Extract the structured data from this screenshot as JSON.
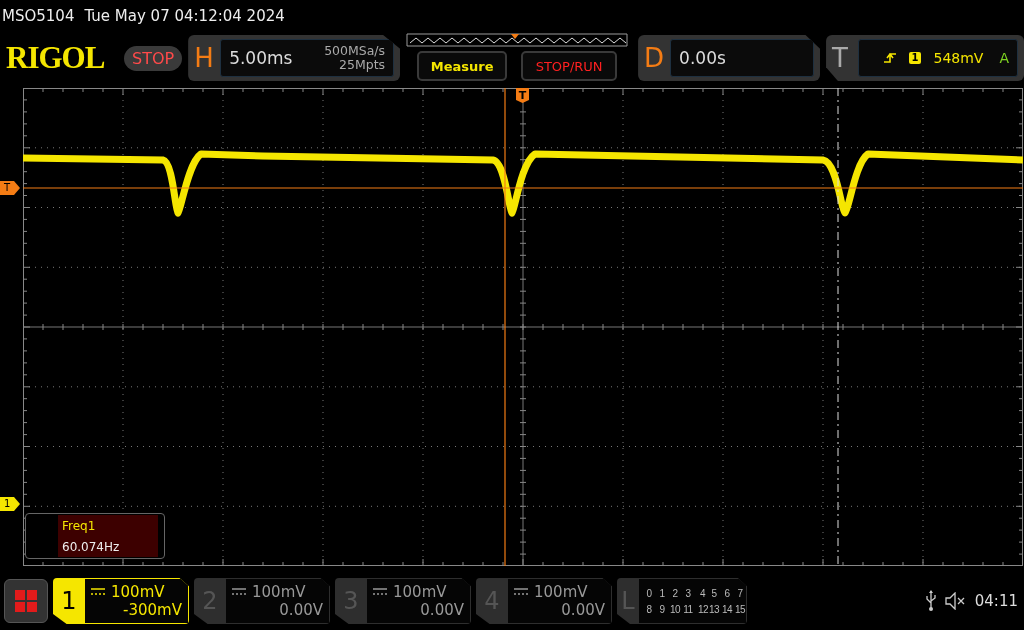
{
  "status_line": {
    "model": "MSO5104",
    "datetime": "Tue May 07 04:12:04 2024"
  },
  "header": {
    "logo": "RIGOL",
    "run_state": "STOP",
    "horizontal": {
      "label": "H",
      "timebase": "5.00ms",
      "sample_rate": "500MSa/s",
      "memory_depth": "25Mpts"
    },
    "buttons": [
      {
        "label": "Measure",
        "kind": "measure"
      },
      {
        "label": "STOP/RUN",
        "kind": "stoprun"
      }
    ],
    "delay": {
      "label": "D",
      "value": "0.00s"
    },
    "trigger": {
      "label": "T",
      "source": "1",
      "level": "548mV",
      "mode": "A"
    }
  },
  "display": {
    "trigger_position_marker": "T",
    "trigger_level_marker": "T",
    "channel_marker": "1",
    "measurement": {
      "name": "Freq1",
      "value": "60.074Hz"
    }
  },
  "channels": [
    {
      "number": "1",
      "scale": "100mV",
      "offset": "-300mV",
      "selected": true
    },
    {
      "number": "2",
      "scale": "100mV",
      "offset": "0.00V",
      "selected": false
    },
    {
      "number": "3",
      "scale": "100mV",
      "offset": "0.00V",
      "selected": false
    },
    {
      "number": "4",
      "scale": "100mV",
      "offset": "0.00V",
      "selected": false
    }
  ],
  "logic": {
    "label": "L",
    "rows": [
      [
        "0",
        "1",
        "2",
        "3",
        "4",
        "5",
        "6",
        "7"
      ],
      [
        "8",
        "9",
        "10",
        "11",
        "12",
        "13",
        "14",
        "15"
      ]
    ]
  },
  "status_bar": {
    "time": "04:11"
  }
}
